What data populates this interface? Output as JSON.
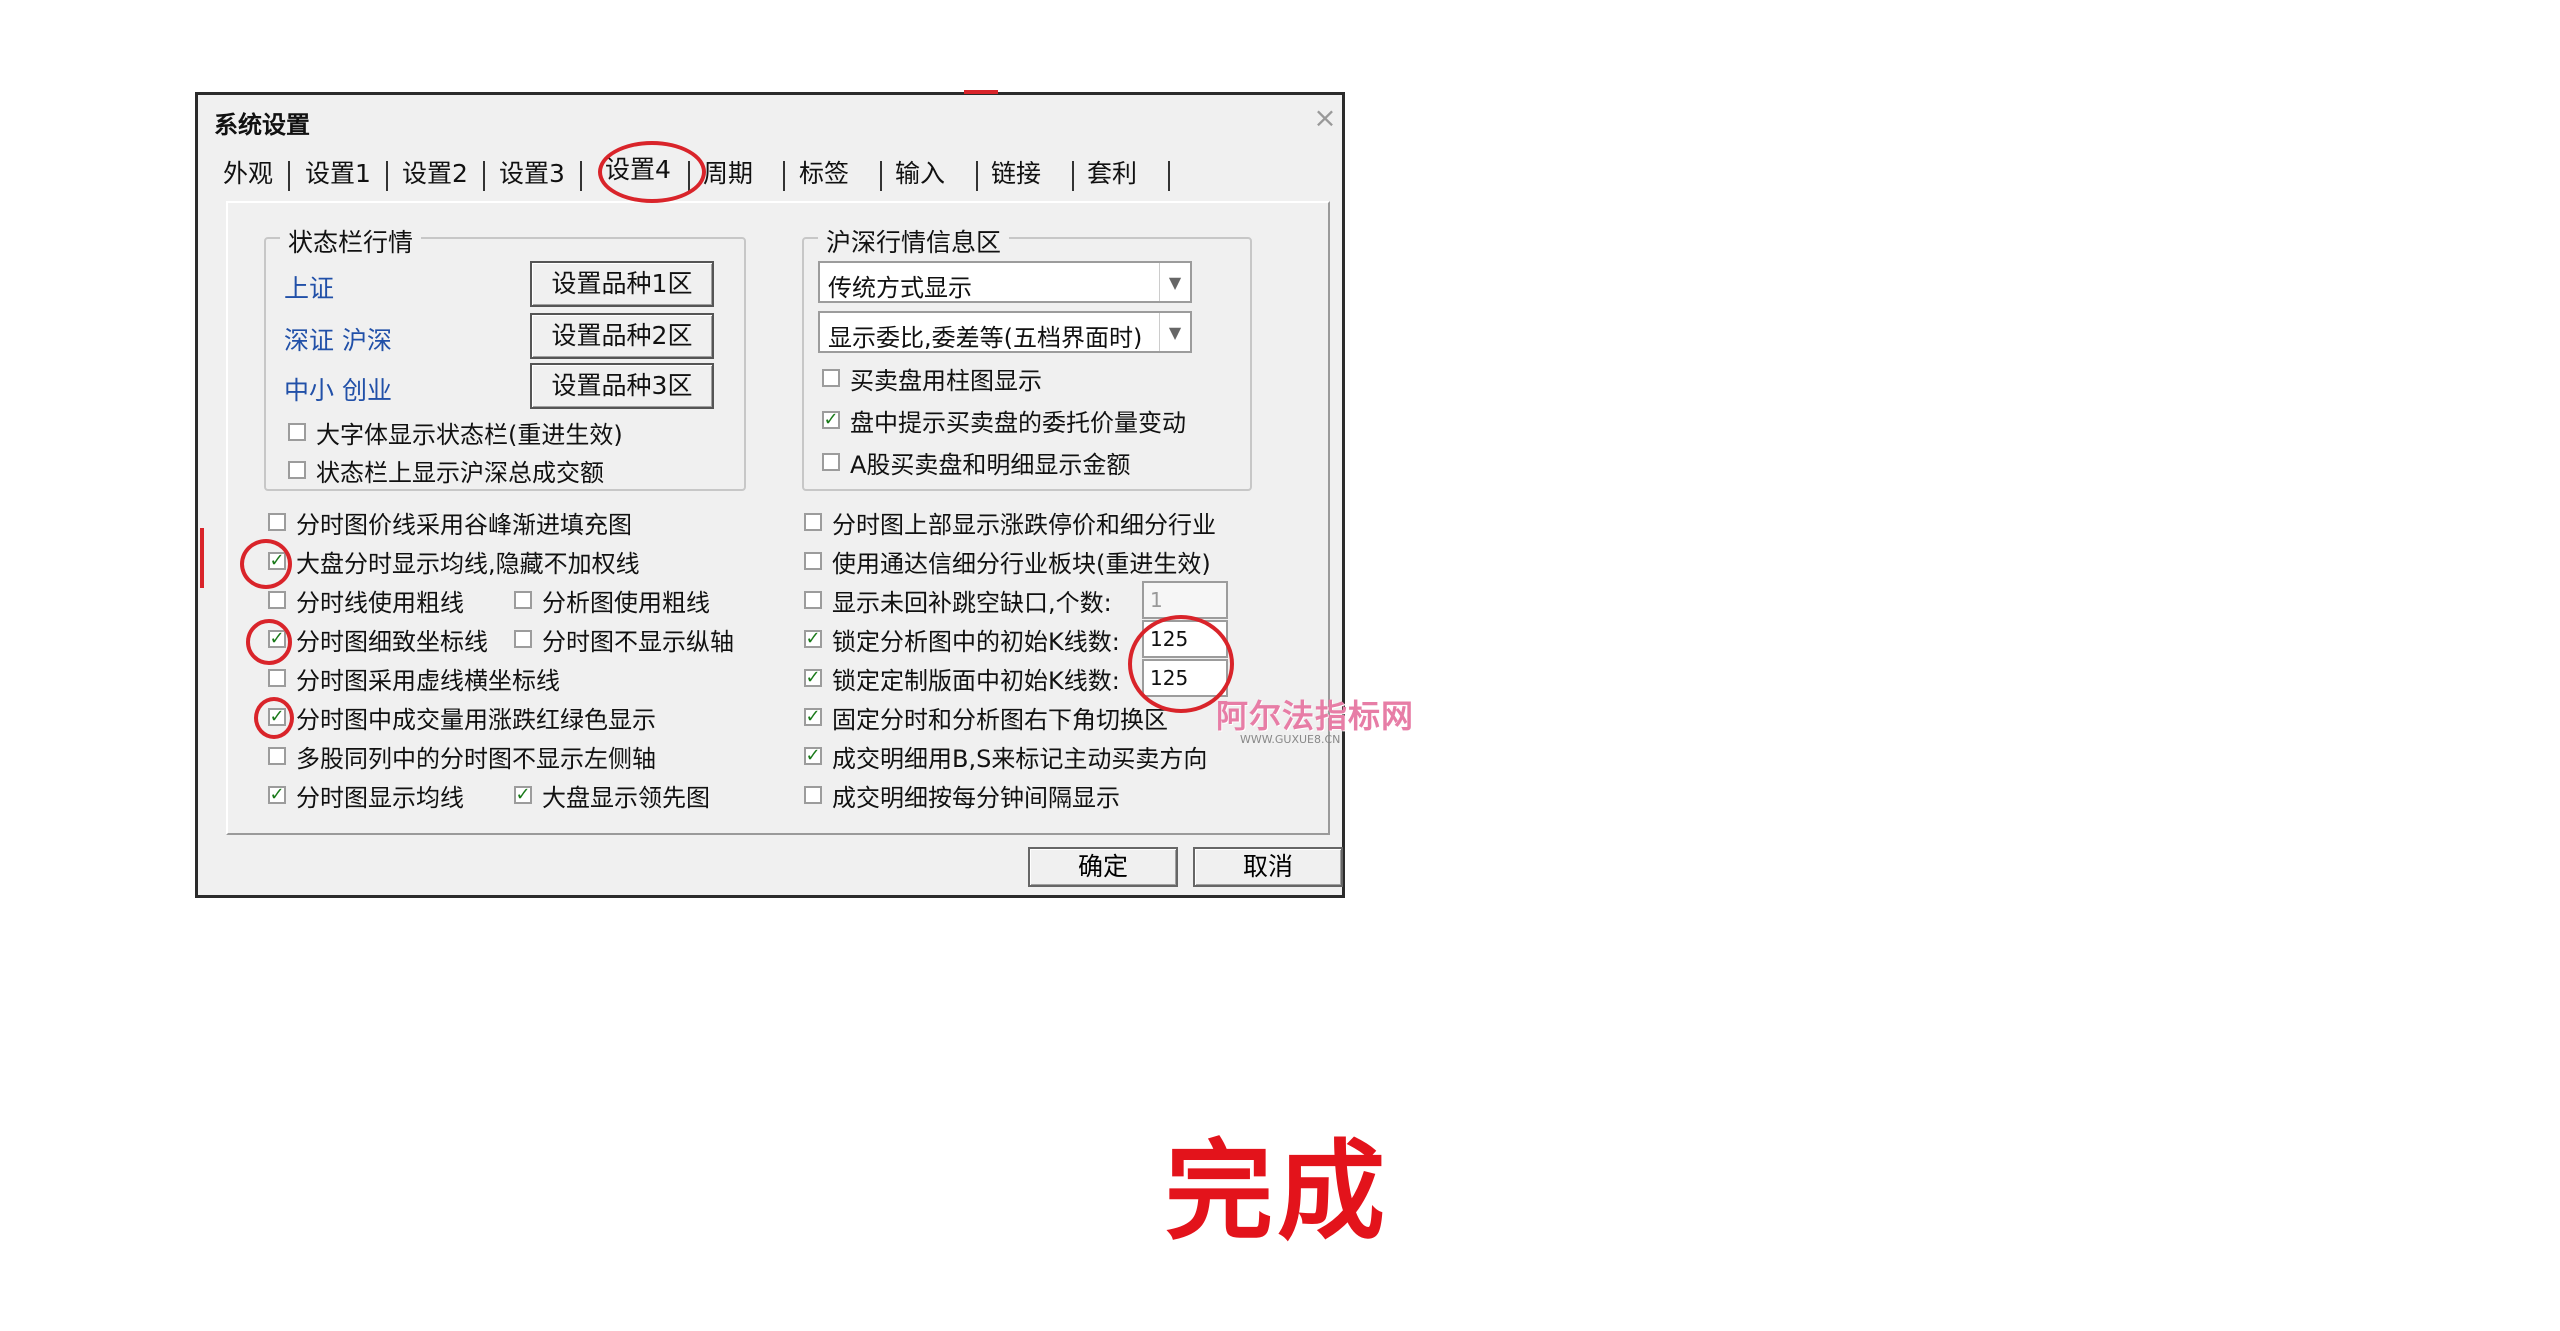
{
  "dialog": {
    "title": "系统设置",
    "close_glyph": "×",
    "tabs": [
      {
        "label": "外观"
      },
      {
        "label": "设置1"
      },
      {
        "label": "设置2"
      },
      {
        "label": "设置3"
      },
      {
        "label": "设置4",
        "active": true
      },
      {
        "label": "周期"
      },
      {
        "label": "标签"
      },
      {
        "label": "输入"
      },
      {
        "label": "链接"
      },
      {
        "label": "套利"
      }
    ]
  },
  "status_bar_group": {
    "legend": "状态栏行情",
    "rows": [
      {
        "label": "上证",
        "button": "设置品种1区"
      },
      {
        "label": "深证 沪深",
        "button": "设置品种2区"
      },
      {
        "label": "中小 创业",
        "button": "设置品种3区"
      }
    ],
    "options": [
      {
        "label": "大字体显示状态栏(重进生效)",
        "checked": false
      },
      {
        "label": "状态栏上显示沪深总成交额",
        "checked": false
      }
    ]
  },
  "hs_group": {
    "legend": "沪深行情信息区",
    "select1": "传统方式显示",
    "select2": "显示委比,委差等(五档界面时)",
    "options": [
      {
        "label": "买卖盘用柱图显示",
        "checked": false
      },
      {
        "label": "盘中提示买卖盘的委托价量变动",
        "checked": true
      },
      {
        "label": "A股买卖盘和明细显示金额",
        "checked": false
      }
    ]
  },
  "left_options": {
    "opt1": {
      "label": "分时图价线采用谷峰渐进填充图",
      "checked": false
    },
    "opt2": {
      "label": "大盘分时显示均线,隐藏不加权线",
      "checked": true
    },
    "opt3a": {
      "label": "分时线使用粗线",
      "checked": false
    },
    "opt3b": {
      "label": "分析图使用粗线",
      "checked": false
    },
    "opt4a": {
      "label": "分时图细致坐标线",
      "checked": true
    },
    "opt4b": {
      "label": "分时图不显示纵轴",
      "checked": false
    },
    "opt5": {
      "label": "分时图采用虚线横坐标线",
      "checked": false
    },
    "opt6": {
      "label": "分时图中成交量用涨跌红绿色显示",
      "checked": true
    },
    "opt7": {
      "label": "多股同列中的分时图不显示左侧轴",
      "checked": false
    },
    "opt8a": {
      "label": "分时图显示均线",
      "checked": true
    },
    "opt8b": {
      "label": "大盘显示领先图",
      "checked": true
    }
  },
  "right_options": {
    "opt1": {
      "label": "分时图上部显示涨跌停价和细分行业",
      "checked": false
    },
    "opt2": {
      "label": "使用通达信细分行业板块(重进生效)",
      "checked": false
    },
    "opt3": {
      "label": "显示未回补跳空缺口,个数:",
      "checked": false,
      "value": "1"
    },
    "opt4": {
      "label": "锁定分析图中的初始K线数:",
      "checked": true,
      "value": "125"
    },
    "opt5": {
      "label": "锁定定制版面中初始K线数:",
      "checked": true,
      "value": "125"
    },
    "opt6": {
      "label": "固定分时和分析图右下角切换区",
      "checked": true
    },
    "opt7": {
      "label": "成交明细用B,S来标记主动买卖方向",
      "checked": true
    },
    "opt8": {
      "label": "成交明细按每分钟间隔显示",
      "checked": false
    }
  },
  "footer": {
    "ok": "确定",
    "cancel": "取消"
  },
  "watermark": {
    "text": "阿尔法指标网",
    "sub": "WWW.GUXUE8.CN"
  },
  "caption": "完成",
  "check_glyph": "✓",
  "dropdown_glyph": "▼",
  "colors": {
    "annotation": "#d9242a",
    "caption": "#e3131b",
    "label_blue": "#2150a8",
    "check_green": "#1a7a1a"
  }
}
